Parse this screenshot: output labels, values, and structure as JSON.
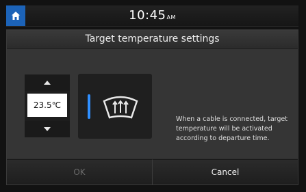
{
  "status_bar": {
    "time": "10:45",
    "ampm": "AM"
  },
  "dialog": {
    "title": "Target temperature settings",
    "temperature": "23.5℃",
    "info": "When a cable is connected, target temperature will be activated according to departure time.",
    "buttons": {
      "ok": "OK",
      "cancel": "Cancel"
    }
  },
  "icons": {
    "home": "home-icon",
    "up": "up-arrow-icon",
    "down": "down-arrow-icon",
    "defrost": "windshield-defrost-icon"
  },
  "colors": {
    "accent": "#1c63b8",
    "indicator": "#2f8fff"
  }
}
